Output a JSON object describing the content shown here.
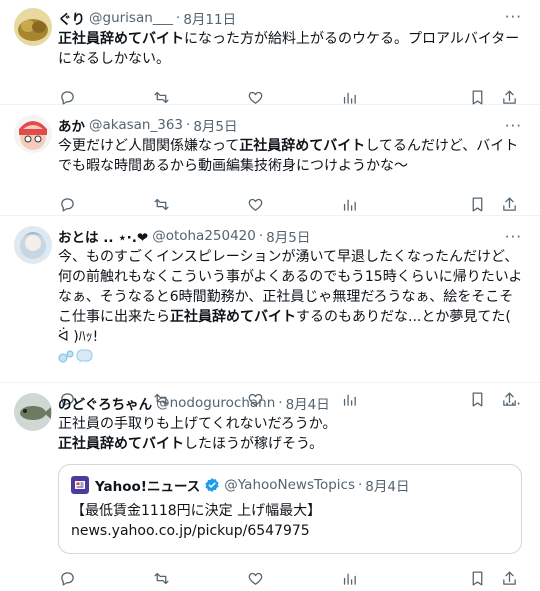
{
  "tweets": [
    {
      "name": "ぐり",
      "handle": "@gurisan___",
      "sep": "·",
      "date": "8月11日",
      "more": "···",
      "text": [
        {
          "t": "正社員辞めてバイト",
          "b": true
        },
        {
          "t": "になった方が給料上がるのウケる。プロアルバイターになるしかない。",
          "b": false
        }
      ]
    },
    {
      "name": "あか",
      "handle": "@akasan_363",
      "sep": "·",
      "date": "8月5日",
      "more": "···",
      "text": [
        {
          "t": "今更だけど人間関係嫌なって",
          "b": false
        },
        {
          "t": "正社員辞めてバイト",
          "b": true
        },
        {
          "t": "してるんだけど、バイトでも暇な時間あるから動画編集技術身につけようかな〜",
          "b": false
        }
      ]
    },
    {
      "name": "おとは .. ⋆·.❤",
      "handle": "@otoha250420",
      "sep": "·",
      "date": "8月5日",
      "more": "···",
      "text": [
        {
          "t": "今、ものすごくインスピレーションが湧いて早退したくなったんだけど、何の前触れもなくこういう事がよくあるのでもう15時くらいに帰りたいよなぁ、そうなると6時間勤務か、正社員じゃ無理だろうなぁ、絵をそこそこ仕事に出来たら",
          "b": false
        },
        {
          "t": "正社員辞めてバイト",
          "b": true
        },
        {
          "t": "するのもありだな...とか夢見てた( ᐛ )ﾊｯ!",
          "b": false
        }
      ]
    },
    {
      "name": "のどぐろちゃん",
      "handle": "@nodogurochann",
      "sep": "·",
      "date": "8月4日",
      "more": "···",
      "text": [
        {
          "t": "正社員の手取りも上げてくれないだろうか。",
          "b": false
        },
        {
          "t": "\n",
          "b": false
        },
        {
          "t": "正社員辞めてバイト",
          "b": true
        },
        {
          "t": "したほうが稼げそう。",
          "b": false
        }
      ],
      "quote": {
        "name": "Yahoo!ニュース",
        "handle": "@YahooNewsTopics",
        "sep": "·",
        "date": "8月4日",
        "line1": "【最低賃金1118円に決定 上げ幅最大】",
        "line2": "news.yahoo.co.jp/pickup/6547975"
      }
    }
  ],
  "icons": [
    "reply-icon",
    "retweet-icon",
    "like-icon",
    "views-icon",
    "bookmark-icon",
    "share-icon"
  ],
  "colors": {
    "text": "#0f1419",
    "secondary": "#536471",
    "border": "#eff3f4",
    "quote_border": "#cfd9de",
    "verified": "#1d9bf0"
  }
}
